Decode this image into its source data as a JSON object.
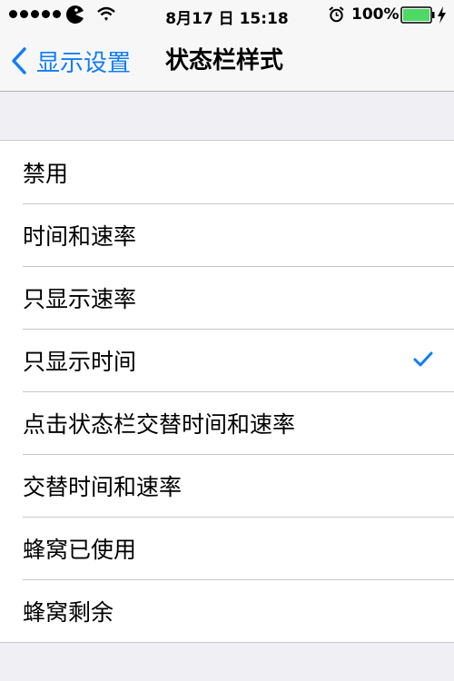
{
  "status_bar": {
    "time": "8月17 日 15:18",
    "battery": "100%",
    "icons": [
      "signal-dots-icon",
      "carrier-icon",
      "wifi-icon",
      "alarm-icon",
      "battery-icon",
      "charging-bolt-icon"
    ],
    "battery_color": "#4cd964"
  },
  "nav": {
    "back_label": "显示设置",
    "title": "状态栏样式"
  },
  "options": [
    {
      "label": "禁用",
      "selected": false
    },
    {
      "label": "时间和速率",
      "selected": false
    },
    {
      "label": "只显示速率",
      "selected": false
    },
    {
      "label": "只显示时间",
      "selected": true
    },
    {
      "label": "点击状态栏交替时间和速率",
      "selected": false
    },
    {
      "label": "交替时间和速率",
      "selected": false
    },
    {
      "label": "蜂窝已使用",
      "selected": false
    },
    {
      "label": "蜂窝剩余",
      "selected": false
    }
  ],
  "accent_color": "#127cf6",
  "check_icon": "checkmark-icon"
}
